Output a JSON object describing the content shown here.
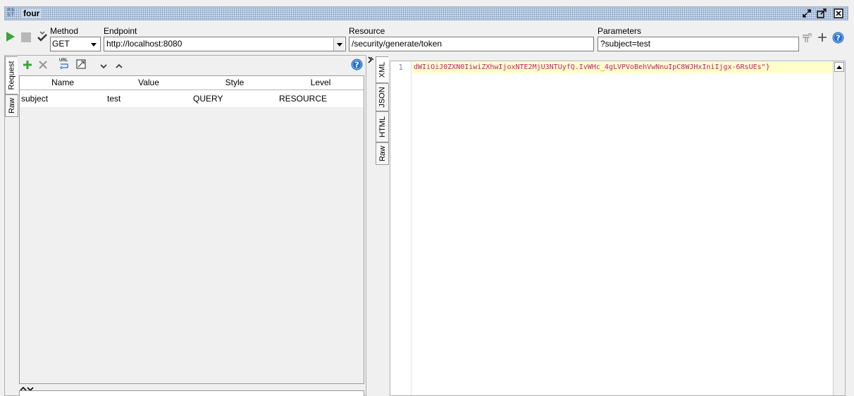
{
  "window": {
    "badge_line1": "RE",
    "badge_line2": "ST",
    "title": "four"
  },
  "toolbar": {
    "method_label": "Method",
    "method_value": "GET",
    "endpoint_label": "Endpoint",
    "endpoint_value": "http://localhost:8080",
    "resource_label": "Resource",
    "resource_value": "/security/generate/token",
    "parameters_label": "Parameters",
    "parameters_value": "?subject=test"
  },
  "request": {
    "tabs": [
      "Request",
      "Raw"
    ],
    "columns": [
      "Name",
      "Value",
      "Style",
      "Level"
    ],
    "rows": [
      {
        "name": "subject",
        "value": "test",
        "style": "QUERY",
        "level": "RESOURCE"
      }
    ],
    "toolbar_icon_text": "URL"
  },
  "response": {
    "tabs": [
      "XML",
      "JSON",
      "HTML",
      "Raw"
    ],
    "line_number": "1",
    "line_text": "dWIiOiJ0ZXN0IiwiZXhwIjoxNTE2MjU3NTUyfQ.IvWHc_4gLVPVoBehVwNnuIpC8WJHxIniIjgx-6RsUEs\"}"
  },
  "colors": {
    "accent_green": "#3aa33a",
    "help_blue": "#2b72c8",
    "json_text": "#c02080",
    "highlight_line": "#ffffc8"
  }
}
